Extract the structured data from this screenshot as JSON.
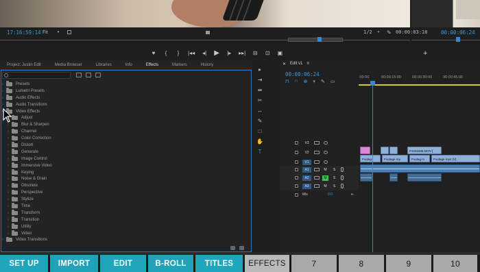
{
  "source_monitor": {
    "timecode": "17:16:59:14",
    "fit": "Fit",
    "resolution": "1/2",
    "duration": "00:00:03:18"
  },
  "program_monitor": {
    "timecode": "00:00:06:24"
  },
  "transport": [
    "♥",
    "{",
    "}",
    "|◂◂",
    "◂|",
    "▶",
    "|▸",
    "▸▸|",
    "⊟",
    "⊡",
    "📷"
  ],
  "panel": {
    "tabs": [
      "Project: Justin Edit",
      "Media Browser",
      "Libraries",
      "Info",
      "Effects",
      "Markers",
      "History"
    ],
    "active_tab": "Effects",
    "tree": [
      {
        "label": "Presets",
        "level": 1
      },
      {
        "label": "Lumetri Presets",
        "level": 1
      },
      {
        "label": "Audio Effects",
        "level": 1
      },
      {
        "label": "Audio Transitions",
        "level": 1
      },
      {
        "label": "Video Effects",
        "level": 1,
        "open": true
      },
      {
        "label": "Adjust",
        "level": 2
      },
      {
        "label": "Blur & Sharpen",
        "level": 2
      },
      {
        "label": "Channel",
        "level": 2
      },
      {
        "label": "Color Correction",
        "level": 2
      },
      {
        "label": "Distort",
        "level": 2
      },
      {
        "label": "Generate",
        "level": 2
      },
      {
        "label": "Image Control",
        "level": 2
      },
      {
        "label": "Immersive Video",
        "level": 2
      },
      {
        "label": "Keying",
        "level": 2
      },
      {
        "label": "Noise & Grain",
        "level": 2
      },
      {
        "label": "Obsolete",
        "level": 2
      },
      {
        "label": "Perspective",
        "level": 2
      },
      {
        "label": "Stylize",
        "level": 2
      },
      {
        "label": "Time",
        "level": 2
      },
      {
        "label": "Transform",
        "level": 2
      },
      {
        "label": "Transition",
        "level": 2
      },
      {
        "label": "Utility",
        "level": 2
      },
      {
        "label": "Video",
        "level": 2
      },
      {
        "label": "Video Transitions",
        "level": 1
      }
    ]
  },
  "timeline": {
    "tab": "Edit v1",
    "timecode": "00:00:06:24",
    "ruler": [
      ":00:00",
      "00:00:15:00",
      "00:00:30:00",
      "00:00:45:00"
    ],
    "tracks": {
      "v3": "V3",
      "v2": "V2",
      "v1": "V1",
      "a1": "A1",
      "a2": "A2",
      "a3": "A3",
      "mix": "Mix",
      "mix_value": "0.0",
      "m": "M",
      "s": "S"
    },
    "clips": {
      "v2_label": "P1033336.MOV [",
      "v1_a": "Footag",
      "v1_b": "Footage.mp",
      "v1_c": "Footag.m",
      "v1_d": "Footage.mp4 [V]"
    }
  },
  "bottom_buttons": [
    "SET UP",
    "IMPORT",
    "EDIT",
    "B-ROLL",
    "TITLES",
    "EFFECTS",
    "7",
    "8",
    "9",
    "10"
  ],
  "colors": {
    "accent_blue": "#3a9bdc",
    "teal": "#1fa6bd",
    "grey": "#a9a9a9"
  }
}
